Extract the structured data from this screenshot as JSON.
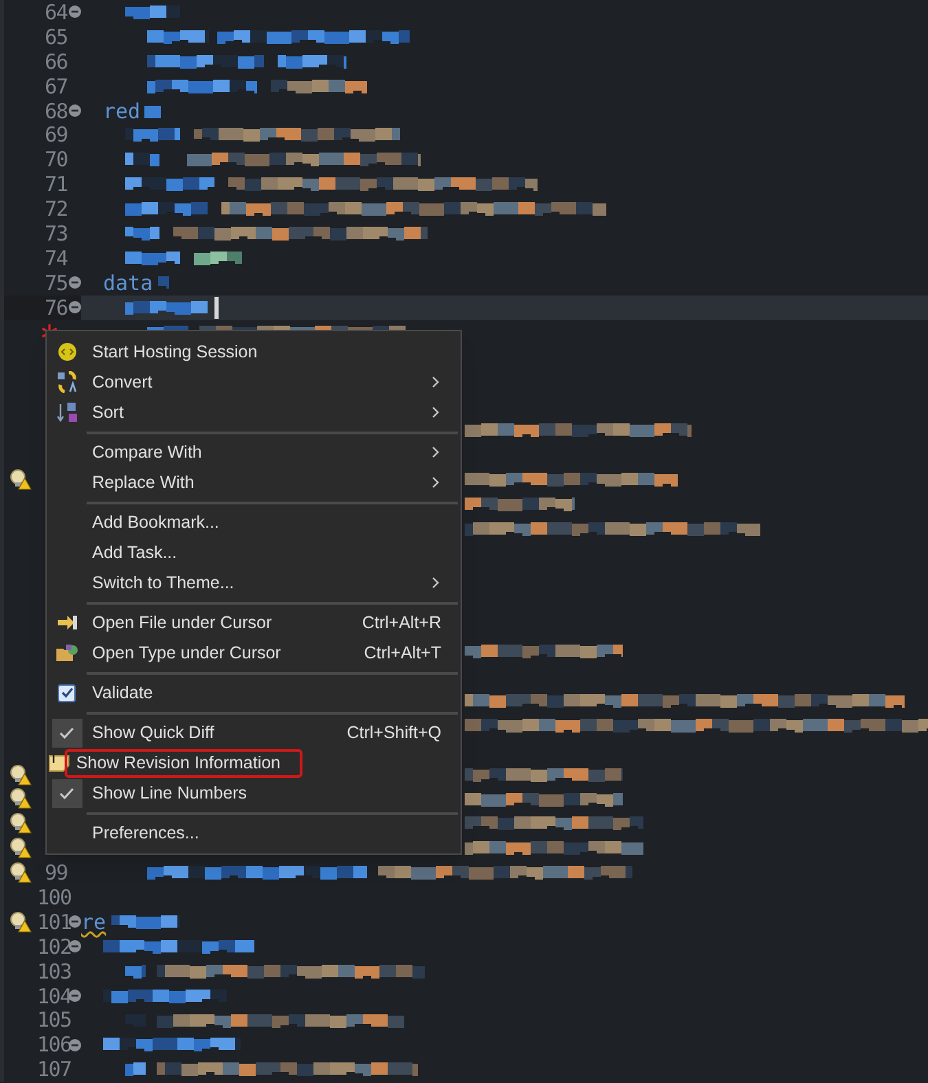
{
  "editor": {
    "lines": [
      {
        "number": "64",
        "expanded": true,
        "current": false,
        "warning": false,
        "starred": false
      },
      {
        "number": "65",
        "current": false,
        "warning": false,
        "starred": false
      },
      {
        "number": "66",
        "current": false,
        "warning": false,
        "starred": false
      },
      {
        "number": "67",
        "current": false,
        "warning": false,
        "starred": false
      },
      {
        "number": "68",
        "text": "red",
        "expanded": true,
        "current": false,
        "warning": false,
        "starred": false
      },
      {
        "number": "69",
        "current": false,
        "warning": false,
        "starred": false
      },
      {
        "number": "70",
        "current": false,
        "warning": false,
        "starred": false
      },
      {
        "number": "71",
        "current": false,
        "warning": false,
        "starred": false
      },
      {
        "number": "72",
        "current": false,
        "warning": false,
        "starred": false
      },
      {
        "number": "73",
        "current": false,
        "warning": false,
        "starred": false
      },
      {
        "number": "74",
        "current": false,
        "warning": false,
        "starred": false
      },
      {
        "number": "75",
        "text": "data",
        "expanded": true,
        "current": false,
        "warning": false,
        "starred": false
      },
      {
        "number": "76",
        "expanded": true,
        "current": true,
        "warning": false,
        "starred": false
      },
      {
        "warning": false,
        "starred": true
      },
      {
        "warning": false,
        "starred": false
      },
      {
        "warning": false,
        "starred": false
      },
      {
        "warning": false,
        "starred": false
      },
      {
        "warning": false,
        "starred": false
      },
      {
        "warning": false,
        "starred": false
      },
      {
        "warning": true,
        "starred": false
      },
      {
        "warning": false,
        "starred": false
      },
      {
        "warning": false,
        "starred": false
      },
      {
        "warning": false,
        "starred": false
      },
      {
        "warning": false,
        "starred": false
      },
      {
        "warning": false,
        "starred": false
      },
      {
        "warning": false,
        "starred": false
      },
      {
        "warning": false,
        "starred": false
      },
      {
        "warning": false,
        "starred": false
      },
      {
        "warning": false,
        "starred": false
      },
      {
        "warning": false,
        "starred": false
      },
      {
        "warning": false,
        "starred": false
      },
      {
        "warning": true,
        "starred": false
      },
      {
        "warning": true,
        "starred": false
      },
      {
        "warning": true,
        "starred": false
      },
      {
        "warning": true,
        "starred": false
      },
      {
        "number": "99",
        "current": false,
        "warning": true,
        "starred": false
      },
      {
        "number": "100",
        "current": false,
        "warning": false,
        "starred": false
      },
      {
        "number": "101",
        "text": "re",
        "expanded": true,
        "current": false,
        "warning": true,
        "starred": false
      },
      {
        "number": "102",
        "expanded": true,
        "current": false,
        "warning": false,
        "starred": false
      },
      {
        "number": "103",
        "current": false,
        "warning": false,
        "starred": false
      },
      {
        "number": "104",
        "expanded": true,
        "current": false,
        "warning": false,
        "starred": false
      },
      {
        "number": "105",
        "current": false,
        "warning": false,
        "starred": false
      },
      {
        "number": "106",
        "expanded": true,
        "current": false,
        "warning": false,
        "starred": false
      },
      {
        "number": "107",
        "current": false,
        "warning": false,
        "starred": false
      }
    ]
  },
  "context_menu": {
    "items": [
      {
        "kind": "item",
        "label": "Start Hosting Session",
        "checked": false,
        "submenu": false,
        "highlighted": false
      },
      {
        "kind": "item",
        "label": "Convert",
        "checked": false,
        "submenu": true,
        "highlighted": false
      },
      {
        "kind": "item",
        "label": "Sort",
        "checked": false,
        "submenu": true,
        "highlighted": false
      },
      {
        "kind": "separator"
      },
      {
        "kind": "item",
        "label": "Compare With",
        "checked": false,
        "submenu": true,
        "highlighted": false
      },
      {
        "kind": "item",
        "label": "Replace With",
        "checked": false,
        "submenu": true,
        "highlighted": false
      },
      {
        "kind": "separator"
      },
      {
        "kind": "item",
        "label": "Add Bookmark...",
        "checked": false,
        "submenu": false,
        "highlighted": false
      },
      {
        "kind": "item",
        "label": "Add Task...",
        "checked": false,
        "submenu": false,
        "highlighted": false
      },
      {
        "kind": "item",
        "label": "Switch to Theme...",
        "checked": false,
        "submenu": true,
        "highlighted": false
      },
      {
        "kind": "separator"
      },
      {
        "kind": "item",
        "label": "Open File under Cursor",
        "shortcut": "Ctrl+Alt+R",
        "checked": false,
        "submenu": false,
        "highlighted": false
      },
      {
        "kind": "item",
        "label": "Open Type under Cursor",
        "shortcut": "Ctrl+Alt+T",
        "checked": false,
        "submenu": false,
        "highlighted": false
      },
      {
        "kind": "separator"
      },
      {
        "kind": "checkbox",
        "label": "Validate",
        "checked": true,
        "submenu": false,
        "highlighted": false
      },
      {
        "kind": "separator"
      },
      {
        "kind": "item",
        "label": "Show Quick Diff",
        "shortcut": "Ctrl+Shift+Q",
        "checked": true,
        "submenu": false,
        "highlighted": false
      },
      {
        "kind": "item",
        "label": "Show Revision Information",
        "checked": false,
        "submenu": false,
        "highlighted": true
      },
      {
        "kind": "item",
        "label": "Show Line Numbers",
        "checked": true,
        "submenu": false,
        "highlighted": false
      },
      {
        "kind": "separator"
      },
      {
        "kind": "item",
        "label": "Preferences...",
        "checked": false,
        "submenu": false,
        "highlighted": false
      }
    ]
  }
}
